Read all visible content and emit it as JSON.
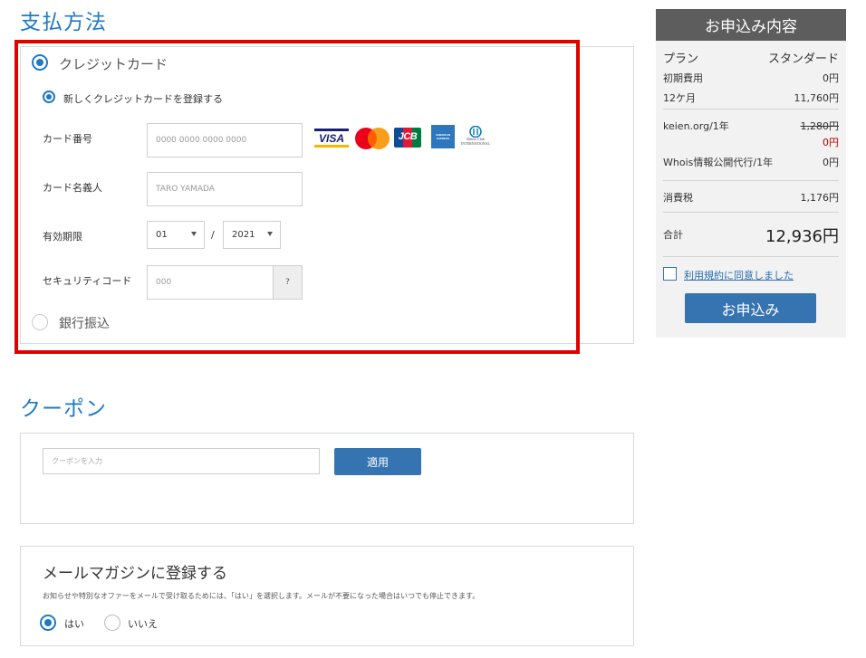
{
  "payment": {
    "title": "支払方法",
    "credit_card_label": "クレジットカード",
    "new_card_label": "新しくクレジットカードを登録する",
    "card_number_label": "カード番号",
    "card_number_placeholder": "0000 0000 0000 0000",
    "card_holder_label": "カード名義人",
    "card_holder_placeholder": "TARO YAMADA",
    "expiry_label": "有効期限",
    "expiry_month": "01",
    "expiry_sep": "/",
    "expiry_year": "2021",
    "security_label": "セキュリティコード",
    "security_placeholder": "000",
    "security_help": "?",
    "bank_label": "銀行振込",
    "card_brands": {
      "visa": "VISA",
      "jcb": "JCB",
      "amex": "AMERICAN EXPRESS",
      "diners": "Diners Club INTERNATIONAL"
    }
  },
  "coupon": {
    "title": "クーポン",
    "placeholder": "クーポンを入力",
    "apply_label": "適用"
  },
  "newsletter": {
    "title": "メールマガジンに登録する",
    "description": "お知らせや特別なオファーをメールで受け取るためには、「はい」を選択します。メールが不要になった場合はいつでも停止できます。",
    "yes_label": "はい",
    "no_label": "いいえ"
  },
  "summary": {
    "title": "お申込み内容",
    "plan_label": "プラン",
    "plan_value": "スタンダード",
    "initial_label": "初期費用",
    "initial_value": "0円",
    "term_label": "12ケ月",
    "term_value": "11,760円",
    "domain_label": "keien.org/1年",
    "domain_old_price": "1,280円",
    "domain_price": "0円",
    "whois_label": "Whois情報公開代行/1年",
    "whois_value": "0円",
    "tax_label": "消費税",
    "tax_value": "1,176円",
    "total_label": "合計",
    "total_value": "12,936円",
    "terms_label": "利用規約に同意しました",
    "submit_label": "お申込み"
  },
  "colors": {
    "accent": "#1f79c4",
    "button": "#3673b1",
    "highlight": "#e00000",
    "strike_red": "#c00000"
  }
}
